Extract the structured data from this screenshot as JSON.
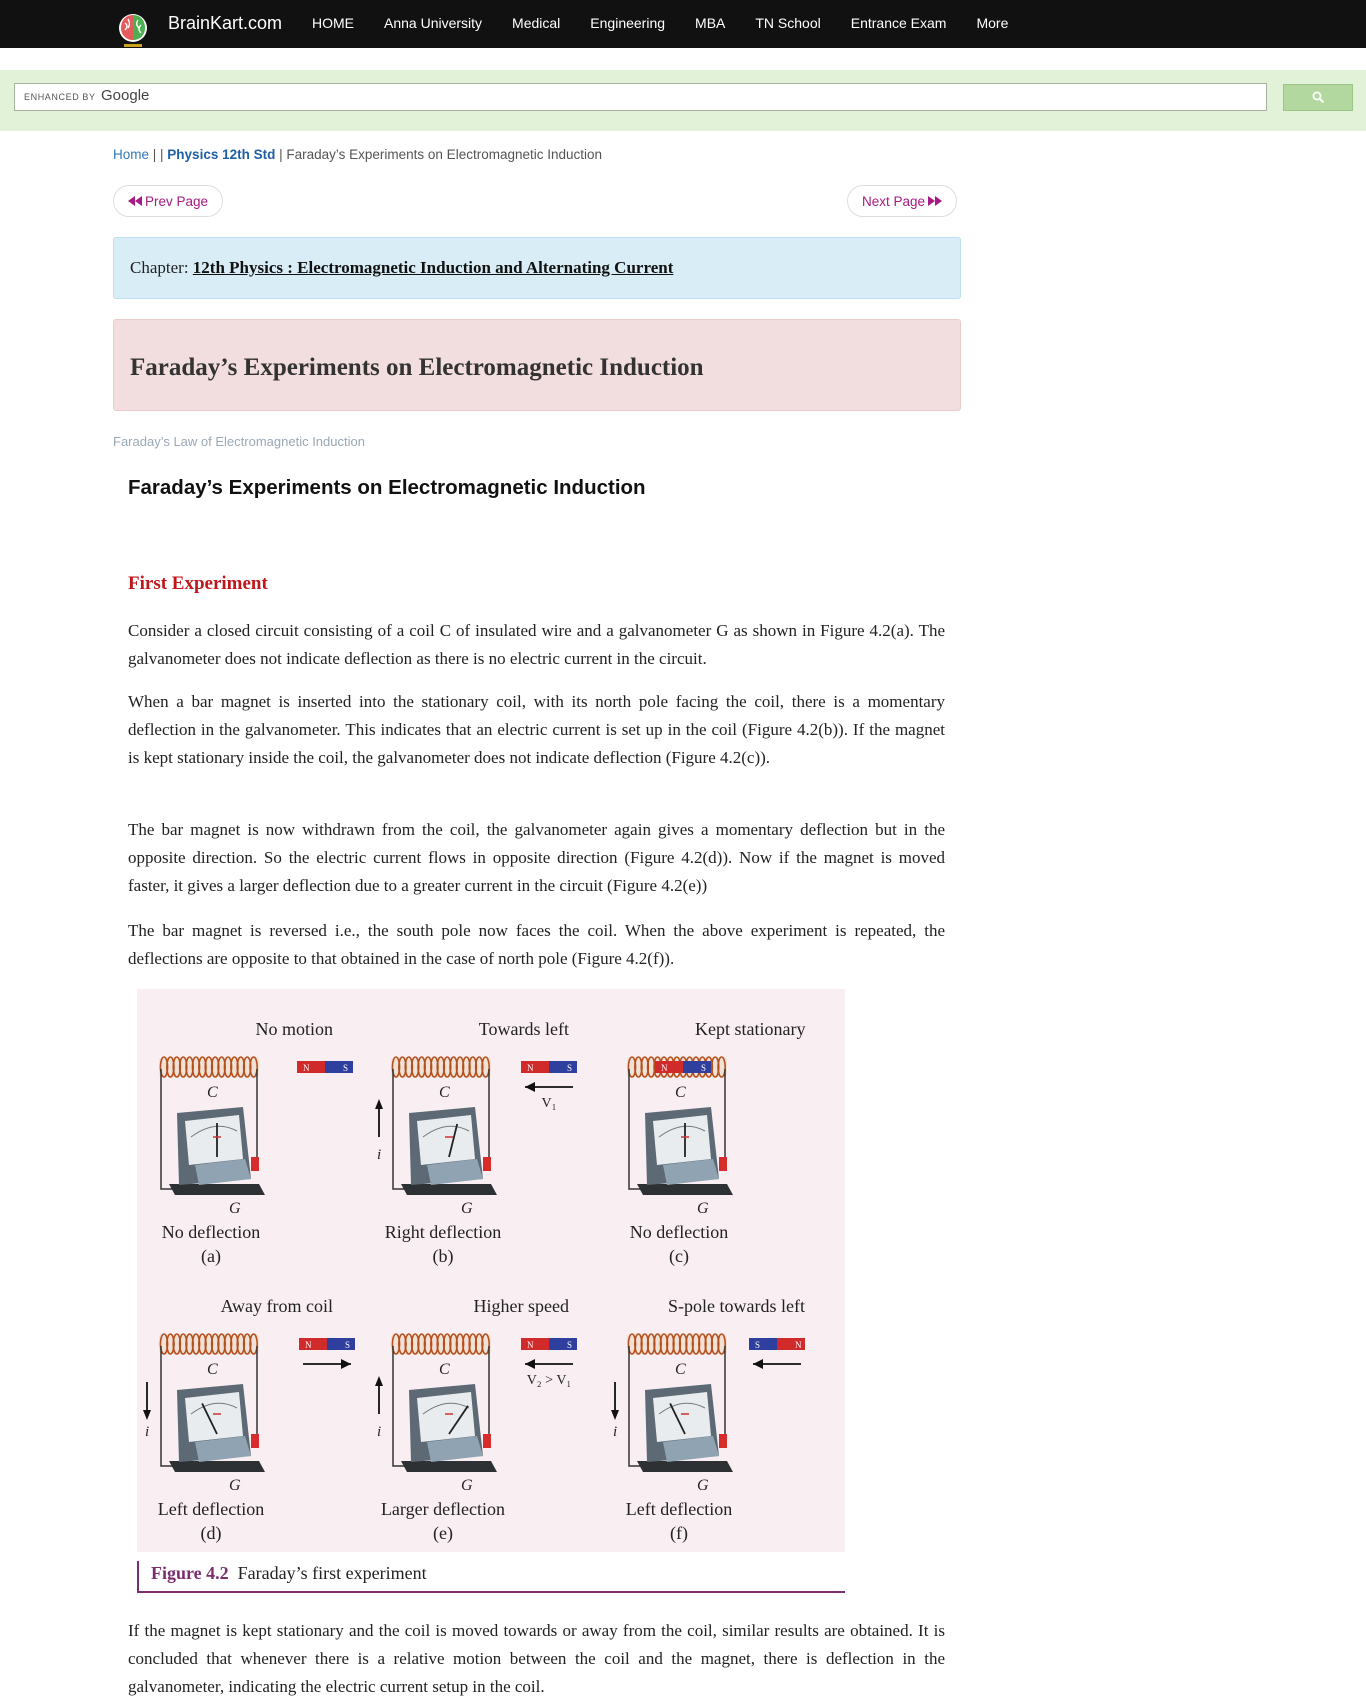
{
  "nav": {
    "site_name": "BrainKart.com",
    "links": [
      "HOME",
      "Anna University",
      "Medical",
      "Engineering",
      "MBA",
      "TN School",
      "Entrance Exam",
      "More"
    ]
  },
  "search": {
    "enhanced_by": "ENHANCED BY",
    "google": "Google",
    "placeholder": ""
  },
  "breadcrumb": {
    "home": "Home",
    "sep1": " | | ",
    "subject": "Physics 12th Std",
    "sep2": " | ",
    "current": "Faraday’s Experiments on Electromagnetic Induction"
  },
  "pager": {
    "prev": "Prev Page",
    "next": "Next Page"
  },
  "chapter": {
    "prefix": "Chapter: ",
    "name": "12th Physics : Electromagnetic Induction and Alternating Current"
  },
  "page_title": "Faraday’s Experiments on Electromagnetic Induction",
  "related_link": "Faraday’s Law of Electromagnetic Induction",
  "article_title": "Faraday’s Experiments on Electromagnetic Induction",
  "section_heading": "First Experiment",
  "paragraphs": [
    "Consider a closed circuit consisting of a coil C of insulated wire and a galvanometer G as shown in Figure 4.2(a). The galvanometer does not indicate deflection as there is no electric current in the circuit.",
    "When a bar magnet is inserted into the stationary coil, with its north pole facing the coil, there is a momentary deflection in the galvanometer. This indicates that an electric current is set up in the coil (Figure 4.2(b)). If the magnet is kept stationary inside the coil, the galvanometer does not indicate deflection (Figure 4.2(c)).",
    "The bar magnet is now withdrawn from the coil, the galvanometer again gives a momentary deflection but in the opposite direction. So the electric current flows in opposite direction (Figure 4.2(d)). Now if the magnet is moved faster, it gives a larger deflection due to a greater current in the circuit (Figure 4.2(e))",
    "The bar magnet is reversed i.e., the south pole now faces the coil. When the above experiment is repeated, the deflections are opposite to that obtained in the case of north pole (Figure 4.2(f)).",
    "If the magnet is kept stationary and the coil is moved towards or away from the coil, similar results are obtained. It is concluded that whenever there is a relative motion between the coil and the magnet, there is deflection in the galvanometer, indicating the electric current setup in the coil."
  ],
  "figure": {
    "panels": [
      {
        "motion": "No motion",
        "result": "No deflection",
        "tag": "(a)",
        "coil": "C",
        "galv": "G",
        "current": "",
        "vel": ""
      },
      {
        "motion": "Towards left",
        "result": "Right deflection",
        "tag": "(b)",
        "coil": "C",
        "galv": "G",
        "current": "i",
        "vel": "V₁"
      },
      {
        "motion": "Kept stationary",
        "result": "No deflection",
        "tag": "(c)",
        "coil": "C",
        "galv": "G",
        "current": "",
        "vel": ""
      },
      {
        "motion": "Away from coil",
        "result": "Left deflection",
        "tag": "(d)",
        "coil": "C",
        "galv": "G",
        "current": "i",
        "vel": ""
      },
      {
        "motion": "Higher speed",
        "result": "Larger deflection",
        "tag": "(e)",
        "coil": "C",
        "galv": "G",
        "current": "i",
        "vel": "V₂ > V₁"
      },
      {
        "motion": "S-pole towards left",
        "result": "Left deflection",
        "tag": "(f)",
        "coil": "C",
        "galv": "G",
        "current": "i",
        "vel": ""
      }
    ],
    "magnet_n": "N",
    "magnet_s": "S",
    "caption_label": "Figure 4.2",
    "caption_text": "Faraday’s first experiment"
  },
  "colors": {
    "nav_bg": "#111111",
    "search_bg": "#e2f2d9",
    "chapter_bg": "#d9edf7",
    "title_bg": "#f2dede",
    "section_red": "#c0171c",
    "pager_magenta": "#a51b83",
    "figure_bg": "#f9eef2",
    "caption_purple": "#7a2e6d"
  }
}
